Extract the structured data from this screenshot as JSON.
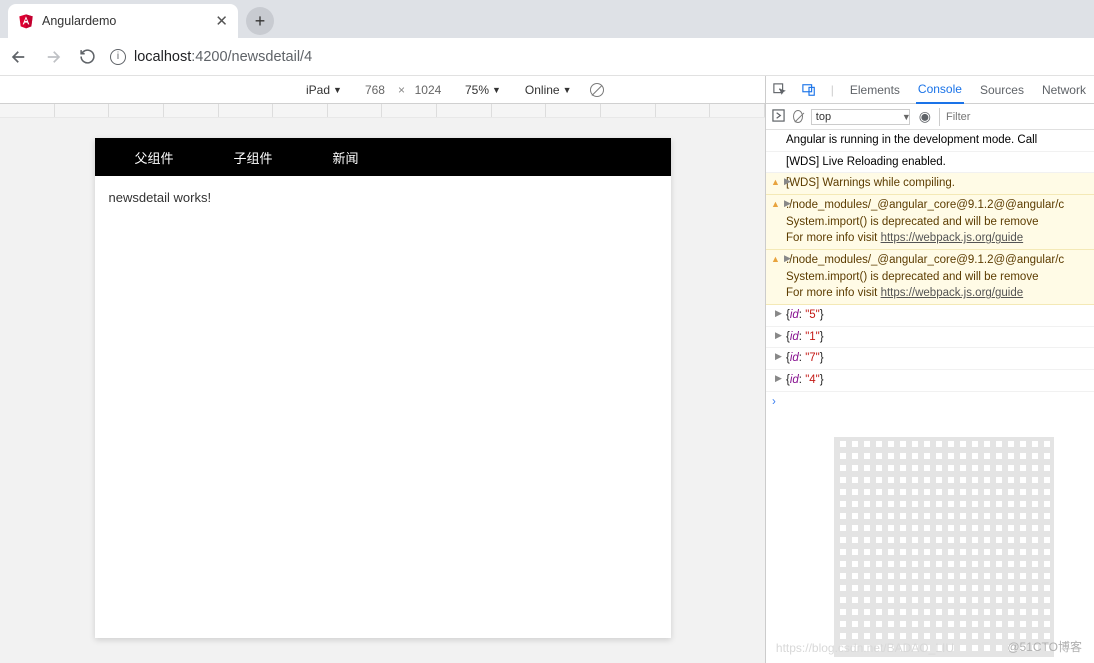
{
  "tab": {
    "title": "Angulardemo"
  },
  "address": {
    "host": "localhost",
    "port_path": ":4200/newsdetail/4"
  },
  "device_toolbar": {
    "device": "iPad",
    "width": "768",
    "height": "1024",
    "zoom": "75%",
    "throttle": "Online"
  },
  "app": {
    "nav": [
      "父组件",
      "子组件",
      "新闻"
    ],
    "content": "newsdetail works!"
  },
  "devtools": {
    "tabs": [
      "Elements",
      "Console",
      "Sources",
      "Network"
    ],
    "active_tab": "Console",
    "context": "top",
    "filter_placeholder": "Filter",
    "messages": [
      {
        "type": "log",
        "text": "Angular is running in the development mode. Call"
      },
      {
        "type": "log",
        "text": "[WDS] Live Reloading enabled."
      },
      {
        "type": "warn",
        "expandable": true,
        "text": "[WDS] Warnings while compiling."
      },
      {
        "type": "warn",
        "expandable": true,
        "text": "./node_modules/_@angular_core@9.1.2@@angular/c",
        "text2": "System.import() is deprecated and will be remove",
        "text3": "For more info visit ",
        "link": "https://webpack.js.org/guide"
      },
      {
        "type": "warn",
        "expandable": true,
        "text": "./node_modules/_@angular_core@9.1.2@@angular/c",
        "text2": "System.import() is deprecated and will be remove",
        "text3": "For more info visit ",
        "link": "https://webpack.js.org/guide"
      },
      {
        "type": "obj",
        "key": "id",
        "val": "\"5\""
      },
      {
        "type": "obj",
        "key": "id",
        "val": "\"1\""
      },
      {
        "type": "obj",
        "key": "id",
        "val": "\"7\""
      },
      {
        "type": "obj",
        "key": "id",
        "val": "\"4\""
      }
    ]
  },
  "watermark": {
    "right": "@51CTO博客",
    "left": "https://blog.csdn.net/BADAO_LIU"
  }
}
